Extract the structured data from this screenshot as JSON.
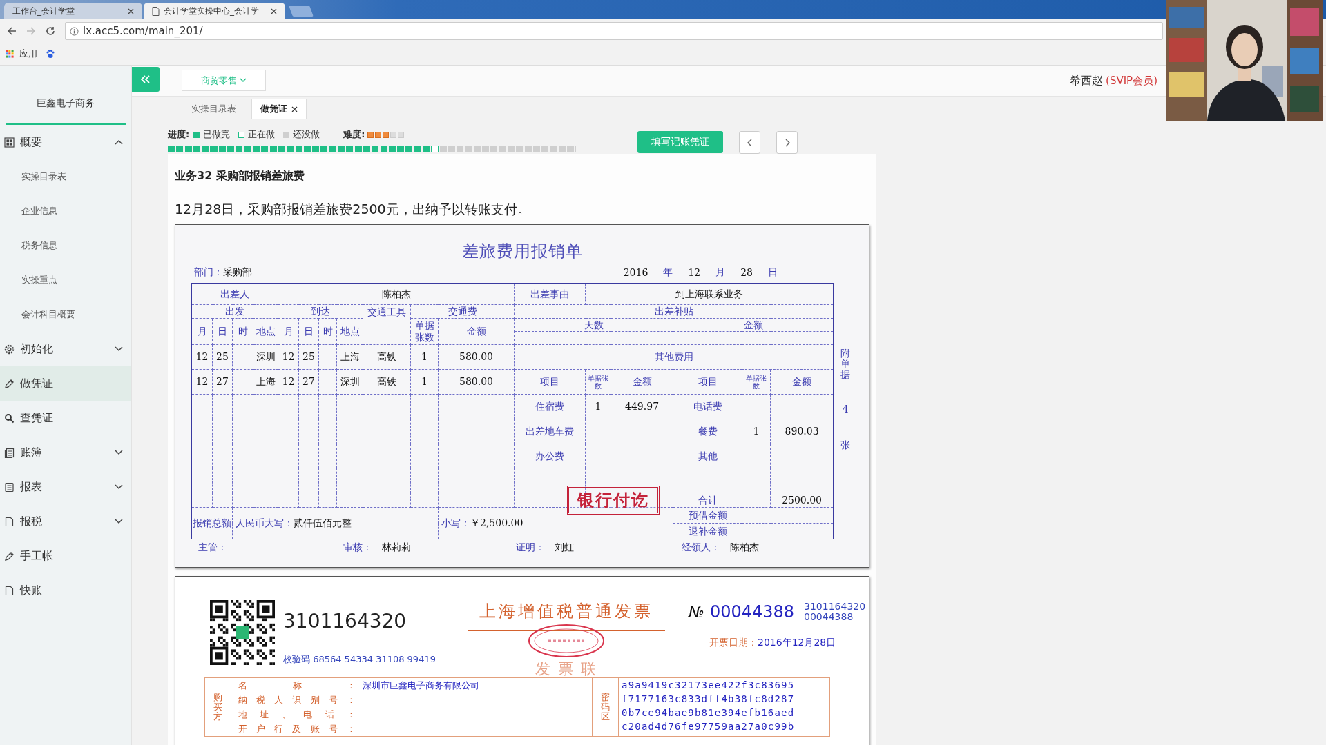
{
  "browser": {
    "tabs": [
      {
        "title": "工作台_会计学堂",
        "selected": false
      },
      {
        "title": "会计学堂实操中心_会计学",
        "selected": true
      }
    ],
    "url": "lx.acc5.com/main_201/",
    "bookmark": "应用"
  },
  "sidebar": {
    "company": "巨鑫电子商务",
    "items": [
      {
        "label": "概要",
        "expanded": true,
        "selected": false,
        "children": [
          {
            "label": "实操目录表"
          },
          {
            "label": "企业信息"
          },
          {
            "label": "税务信息"
          },
          {
            "label": "实操重点"
          },
          {
            "label": "会计科目概要"
          }
        ]
      },
      {
        "label": "初始化",
        "expanded": false,
        "selected": false
      },
      {
        "label": "做凭证",
        "selected": true
      },
      {
        "label": "查凭证",
        "selected": false
      },
      {
        "label": "账簿",
        "expanded": false,
        "selected": false
      },
      {
        "label": "报表",
        "expanded": false,
        "selected": false
      },
      {
        "label": "报税",
        "expanded": false,
        "selected": false
      },
      {
        "label": "手工帐",
        "selected": false
      },
      {
        "label": "快账",
        "selected": false
      }
    ]
  },
  "header": {
    "industry": "商贸零售",
    "user": "希西赵",
    "membership": "(SVIP会员)"
  },
  "page_tabs": [
    {
      "label": "实操目录表",
      "selected": false,
      "closable": false
    },
    {
      "label": "做凭证",
      "selected": true,
      "closable": true
    }
  ],
  "progress": {
    "label": "进度:",
    "legend": [
      {
        "label": "已做完",
        "kind": "done"
      },
      {
        "label": "正在做",
        "kind": "current"
      },
      {
        "label": "还没做",
        "kind": "todo"
      }
    ],
    "difficulty_label": "难度:",
    "stars": 3,
    "level": 0.646
  },
  "fill_button": "填写记账凭证",
  "task": {
    "title": "业务32 采购部报销差旅费",
    "description": "12月28日，采购部报销差旅费2500元，出纳予以转账支付。"
  },
  "expense_form": {
    "title": "差旅费用报销单",
    "department_label": "部门：",
    "department": "采购部",
    "date": [
      {
        "text": "2016",
        "kind": "value"
      },
      {
        "text": "年",
        "kind": "label"
      },
      {
        "text": "12",
        "kind": "value"
      },
      {
        "text": "月",
        "kind": "label"
      },
      {
        "text": "28",
        "kind": "value"
      },
      {
        "text": "日",
        "kind": "label"
      }
    ],
    "rows": [
      [
        {
          "text": "出差人",
          "kind": "label",
          "colspan": 4
        },
        {
          "text": "陈柏杰",
          "kind": "value",
          "colspan": 7
        },
        {
          "text": "出差事由",
          "kind": "label"
        },
        {
          "text": "到上海联系业务",
          "kind": "value",
          "colspan": 5
        }
      ],
      [
        {
          "text": "出发",
          "kind": "label",
          "colspan": 4
        },
        {
          "text": "到达",
          "kind": "label",
          "colspan": 4
        },
        {
          "text": "交通工具",
          "kind": "label",
          "rowspan": 3
        },
        {
          "text": "交通费",
          "kind": "label",
          "colspan": 2
        },
        {
          "text": "出差补贴",
          "kind": "label",
          "colspan": 6
        }
      ],
      [
        {
          "text": "月",
          "kind": "label",
          "rowspan": 2
        },
        {
          "text": "日",
          "kind": "label",
          "rowspan": 2
        },
        {
          "text": "时",
          "kind": "label",
          "rowspan": 2
        },
        {
          "text": "地点",
          "kind": "label",
          "rowspan": 2
        },
        {
          "text": "月",
          "kind": "label",
          "rowspan": 2
        },
        {
          "text": "日",
          "kind": "label",
          "rowspan": 2
        },
        {
          "text": "时",
          "kind": "label",
          "rowspan": 2
        },
        {
          "text": "地点",
          "kind": "label",
          "rowspan": 2
        },
        {
          "text": "单据张数",
          "kind": "label",
          "rowspan": 2
        },
        {
          "text": "金额",
          "kind": "label",
          "rowspan": 2
        },
        {
          "text": "天数",
          "kind": "label",
          "colspan": 3
        },
        {
          "text": "金额",
          "kind": "label",
          "colspan": 3
        }
      ],
      [
        {
          "colspan": 3
        },
        {
          "colspan": 3
        }
      ],
      [
        {
          "text": "12",
          "kind": "value"
        },
        {
          "text": "25",
          "kind": "value"
        },
        {},
        {
          "text": "深圳",
          "kind": "value"
        },
        {
          "text": "12",
          "kind": "value"
        },
        {
          "text": "25",
          "kind": "value"
        },
        {},
        {
          "text": "上海",
          "kind": "value"
        },
        {
          "text": "高铁",
          "kind": "value"
        },
        {
          "text": "1",
          "kind": "value"
        },
        {
          "text": "580.00",
          "kind": "value"
        },
        {
          "text": "其他费用",
          "kind": "label",
          "colspan": 6
        }
      ],
      [
        {
          "text": "12",
          "kind": "value"
        },
        {
          "text": "27",
          "kind": "value"
        },
        {},
        {
          "text": "上海",
          "kind": "value"
        },
        {
          "text": "12",
          "kind": "value"
        },
        {
          "text": "27",
          "kind": "value"
        },
        {},
        {
          "text": "深圳",
          "kind": "value"
        },
        {
          "text": "高铁",
          "kind": "value"
        },
        {
          "text": "1",
          "kind": "value"
        },
        {
          "text": "580.00",
          "kind": "value"
        },
        {
          "text": "项目",
          "kind": "label"
        },
        {
          "text": "单据张数",
          "kind": "small"
        },
        {
          "text": "金额",
          "kind": "label"
        },
        {
          "text": "项目",
          "kind": "label"
        },
        {
          "text": "单据张数",
          "kind": "small"
        },
        {
          "text": "金额",
          "kind": "label"
        }
      ],
      [
        {},
        {},
        {},
        {},
        {},
        {},
        {},
        {},
        {},
        {},
        {},
        {
          "text": "住宿费",
          "kind": "label"
        },
        {
          "text": "1",
          "kind": "value"
        },
        {
          "text": "449.97",
          "kind": "value"
        },
        {
          "text": "电话费",
          "kind": "label"
        },
        {},
        {}
      ],
      [
        {},
        {},
        {},
        {},
        {},
        {},
        {},
        {},
        {},
        {},
        {},
        {
          "text": "出差地车费",
          "kind": "label"
        },
        {},
        {},
        {
          "text": "餐费",
          "kind": "label"
        },
        {
          "text": "1",
          "kind": "value"
        },
        {
          "text": "890.03",
          "kind": "value"
        }
      ],
      [
        {},
        {},
        {},
        {},
        {},
        {},
        {},
        {},
        {},
        {},
        {},
        {
          "text": "办公费",
          "kind": "label"
        },
        {},
        {},
        {
          "text": "其他",
          "kind": "label"
        },
        {},
        {}
      ],
      [
        {},
        {},
        {},
        {},
        {},
        {},
        {},
        {},
        {},
        {},
        {},
        {},
        {},
        {},
        {},
        {},
        {}
      ],
      [
        {},
        {},
        {},
        {},
        {},
        {},
        {},
        {},
        {},
        {},
        {},
        {},
        {},
        {},
        {
          "text": "合计",
          "kind": "label"
        },
        {},
        {
          "text": "2500.00",
          "kind": "value"
        }
      ],
      [
        {
          "text": "报销总额",
          "kind": "label",
          "colspan": 2,
          "rowspan": 2
        },
        {
          "prefix": "人民币大写：",
          "text": "贰仟伍佰元整",
          "kind": "value",
          "colspan": 8,
          "rowspan": 2
        },
        {
          "prefix": "小写：",
          "text": "￥2,500.00",
          "kind": "value",
          "colspan": 4,
          "rowspan": 2
        },
        {
          "text": "预借金额",
          "kind": "label"
        },
        {
          "colspan": 2
        }
      ],
      [
        {
          "text": "退补金额",
          "kind": "label"
        },
        {
          "colspan": 2
        }
      ]
    ],
    "signatures": [
      {
        "label": "主管："
      },
      {
        "label": "审核：",
        "value": "林莉莉"
      },
      {
        "label": "证明：",
        "value": "刘虹"
      },
      {
        "label": "经领人：",
        "value": "陈柏杰"
      }
    ],
    "attachment": {
      "top": "附单据",
      "count": "4",
      "bottom": "张"
    },
    "stamp": "银行付讫"
  },
  "invoice": {
    "code": "3101164320",
    "title": "上海增值税普通发票",
    "copy": "发 票 联",
    "no_label": "№",
    "number": "00044388",
    "small_code": "3101164320",
    "small_number": "00044388",
    "date_label": "开票日期：",
    "date": "2016年12月28日",
    "check_code": "校验码 68564 54334 31108 99419",
    "buyer_label": "购买方",
    "buyer": [
      {
        "label": "名称：",
        "value": "深圳市巨鑫电子商务有限公司"
      },
      {
        "label": "纳税人识别号："
      },
      {
        "label": "地址、电话："
      },
      {
        "label": "开户行及账号："
      }
    ],
    "cipher_label": "密码区",
    "cipher": [
      "a9a9419c32173ee422f3c83695",
      "f7177163c833dff4b38fc8d287",
      "0b7ce94bae9b81e394efb16aed",
      "c20ad4d76fe97759aa27a0c99b"
    ]
  }
}
